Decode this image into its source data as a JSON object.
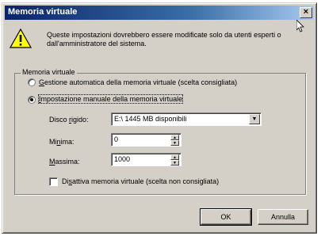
{
  "window": {
    "title": "Memoria virtuale",
    "close_label": "×"
  },
  "warning": {
    "icon": "warning-icon",
    "text": "Queste impostazioni dovrebbero essere modificate solo da utenti esperti o dall'amministratore del sistema."
  },
  "group": {
    "legend": "Memoria virtuale",
    "auto_option": {
      "mnemonic": "G",
      "rest": "estione automatica della memoria virtuale (scelta consigliata)",
      "selected": false
    },
    "manual_option": {
      "mnemonic": "I",
      "rest": "mpostazione manuale della memoria virtuale",
      "selected": true
    },
    "disk": {
      "label_pre": "Disco ",
      "label_mnemonic": "r",
      "label_post": "igido:",
      "value": "E:\\ 1445 MB disponibili"
    },
    "minimum": {
      "label_pre": "Mi",
      "label_mnemonic": "n",
      "label_post": "ima:",
      "value": "0"
    },
    "maximum": {
      "label_pre": "",
      "label_mnemonic": "M",
      "label_post": "assima:",
      "value": "1000"
    },
    "disable_option": {
      "label_pre": "Di",
      "label_mnemonic": "s",
      "label_post": "attiva memoria virtuale (scelta non consigliata)",
      "checked": false
    }
  },
  "buttons": {
    "ok": "OK",
    "cancel": "Annulla"
  }
}
